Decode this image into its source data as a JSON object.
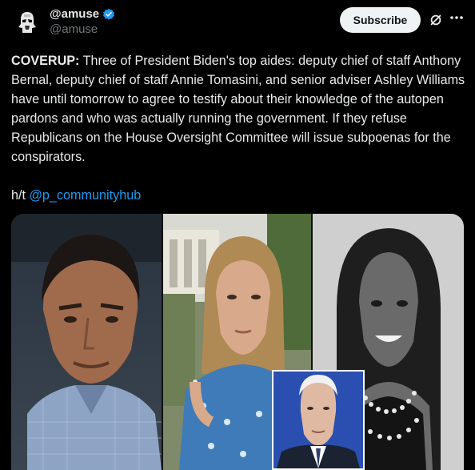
{
  "post": {
    "display_name": "@amuse",
    "handle": "@amuse",
    "subscribe_label": "Subscribe",
    "body_lead": "COVERUP:",
    "body_text": " Three of President Biden's top aides: deputy chief of staff Anthony Bernal, deputy chief of staff Annie Tomasini, and senior adviser Ashley Williams have until tomorrow to agree to testify about their knowledge of the autopen pardons and who was actually running the government. If they refuse Republicans on the House Oversight Committee will issue subpoenas for the conspirators.",
    "hat_tip": "h/t ",
    "mention": "@p_communityhub"
  },
  "colors": {
    "background": "#000000",
    "text": "#e7e9ea",
    "muted": "#71767b",
    "link": "#1d9bf0",
    "verified": "#1d9bf0",
    "button_bg": "#eff3f4"
  },
  "icons": {
    "avatar": "stormtrooper-avatar",
    "verified": "verified-badge-icon",
    "grok": "grok-icon",
    "more": "more-dots-icon"
  }
}
